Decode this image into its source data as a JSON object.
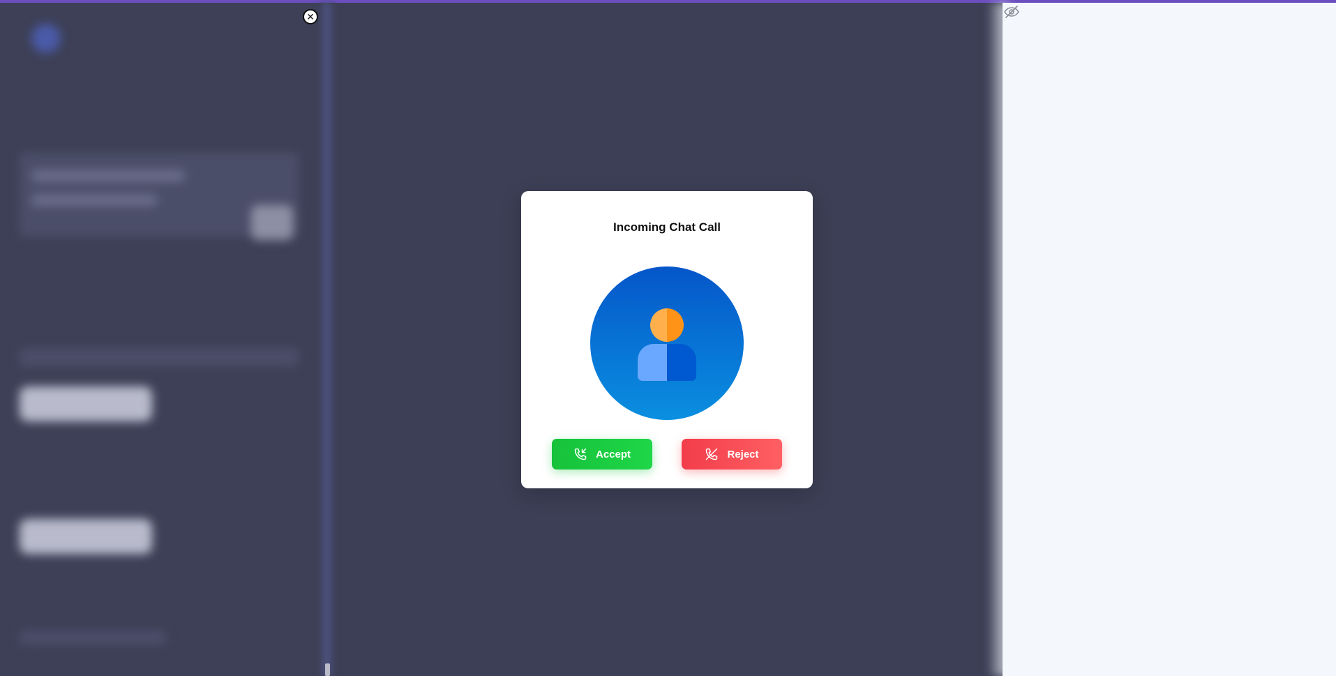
{
  "modal": {
    "title": "Incoming Chat Call",
    "accept_label": "Accept",
    "reject_label": "Reject"
  },
  "colors": {
    "accept": "#1fd648",
    "reject": "#f23d4a",
    "overlay": "#3c3f55",
    "accent_bar": "#6b4fbf",
    "avatar_blue": "#0a72d8",
    "avatar_orange": "#ff9a2e"
  },
  "icons": {
    "close": "close-icon",
    "hide": "eye-off-icon",
    "caller": "user-avatar-icon",
    "accept": "phone-incoming-icon",
    "reject": "phone-off-icon"
  }
}
